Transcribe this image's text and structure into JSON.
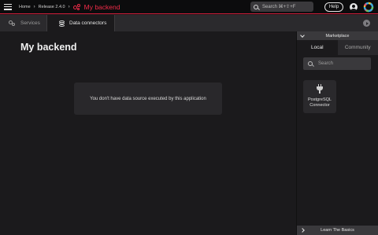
{
  "topbar": {
    "breadcrumbs": [
      "Home",
      "Release 2.4.0"
    ],
    "app_name": "My backend",
    "search_placeholder": "Search ⌘+⇧+F",
    "help_label": "Help",
    "accent_color": "#d11d3a"
  },
  "tabs": {
    "services_label": "Services",
    "dataconnectors_label": "Data connectors",
    "active": "Data connectors"
  },
  "main": {
    "title": "My backend",
    "empty_message": "You don't have data source executed by this application"
  },
  "sidebar": {
    "marketplace_title": "Marketplace",
    "tab_local": "Local",
    "tab_community": "Community",
    "active_tab": "Local",
    "search_placeholder": "Search",
    "connectors": [
      {
        "label": "PostgreSQL Connector",
        "icon": "plug-icon"
      }
    ],
    "footer_label": "Learn The Basics"
  }
}
